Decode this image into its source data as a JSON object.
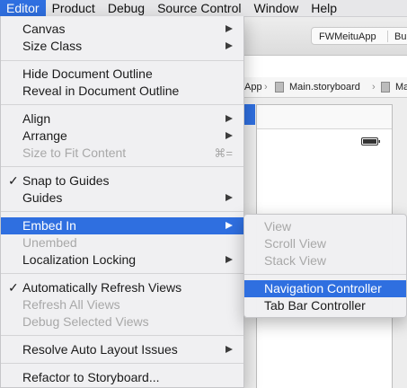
{
  "menubar": {
    "items": [
      "Editor",
      "Product",
      "Debug",
      "Source Control",
      "Window",
      "Help"
    ],
    "active": "Editor"
  },
  "background": {
    "scheme_app": "FWMeituApp",
    "scheme_device": "Bui",
    "jumpbar": {
      "seg1": "App",
      "seg2": "Main.storyboard",
      "seg3": "Mai"
    }
  },
  "editor_menu": {
    "canvas": "Canvas",
    "size_class": "Size Class",
    "hide_outline": "Hide Document Outline",
    "reveal_outline": "Reveal in Document Outline",
    "align": "Align",
    "arrange": "Arrange",
    "size_to_fit": "Size to Fit Content",
    "size_to_fit_shortcut": "⌘=",
    "snap_to_guides": "Snap to Guides",
    "guides": "Guides",
    "embed_in": "Embed In",
    "unembed": "Unembed",
    "localization_locking": "Localization Locking",
    "auto_refresh": "Automatically Refresh Views",
    "refresh_all": "Refresh All Views",
    "debug_selected": "Debug Selected Views",
    "resolve_auto_layout": "Resolve Auto Layout Issues",
    "refactor": "Refactor to Storyboard...",
    "checkmark": "✓"
  },
  "embed_menu": {
    "view": "View",
    "scroll_view": "Scroll View",
    "stack_view": "Stack View",
    "navigation_controller": "Navigation Controller",
    "tab_bar_controller": "Tab Bar Controller"
  },
  "colors": {
    "highlight": "#2f6fe0",
    "disabled_text": "#a8a8a8"
  }
}
